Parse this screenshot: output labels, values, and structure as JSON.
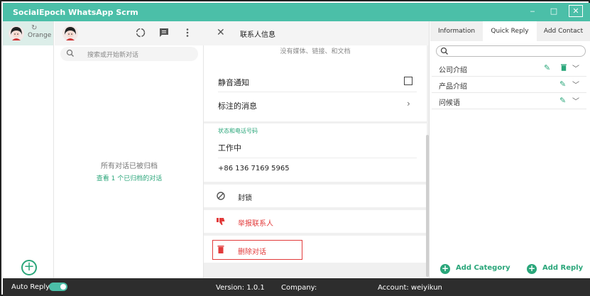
{
  "app": {
    "title": "SocialEpoch WhatsApp Scrm"
  },
  "window": {
    "min": "‒",
    "max": "□",
    "close": "✕"
  },
  "account": {
    "name": "Orange",
    "refresh_icon": "↻"
  },
  "chatlist": {
    "search_placeholder": "搜索或开始新对话",
    "archived_text": "所有对话已被归档",
    "archived_link": "查看 1 个已归档的对话"
  },
  "contact_info": {
    "header_title": "联系人信息",
    "media_text": "没有媒体、链接、和文档",
    "mute_label": "静音通知",
    "starred_label": "标注的消息",
    "status_section_label": "状态和电话号码",
    "about": "工作中",
    "phone": "+86 136 7169 5965",
    "block_label": "封锁",
    "report_label": "举报联系人",
    "delete_label": "删除对话"
  },
  "right_panel": {
    "tabs": [
      "Information",
      "Quick Reply",
      "Add Contact"
    ],
    "active_tab": "Quick Reply",
    "categories": [
      {
        "label": "公司介绍",
        "deletable": true
      },
      {
        "label": "产品介绍",
        "deletable": false
      },
      {
        "label": "问候语",
        "deletable": false
      }
    ],
    "add_category": "Add Category",
    "add_reply": "Add Reply"
  },
  "footer": {
    "auto_reply": "Auto Reply",
    "auto_reply_on": true,
    "version": "Version:  1.0.1",
    "company": "Company:  ",
    "account": "Account:  weiyikun"
  },
  "colors": {
    "accent": "#4bbfa8",
    "green": "#2aa67a",
    "danger": "#e23b3b",
    "footer": "#2d2d2d"
  }
}
